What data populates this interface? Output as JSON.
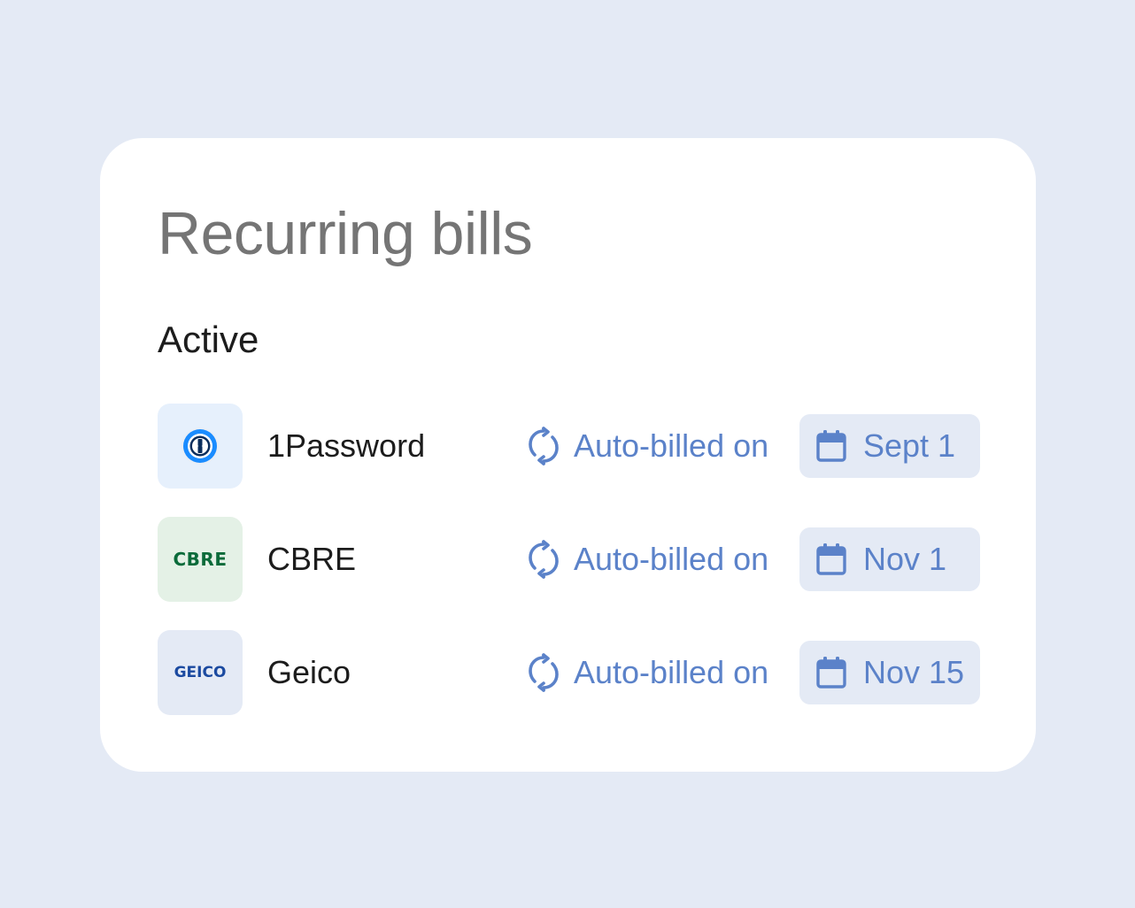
{
  "title": "Recurring bills",
  "section_label": "Active",
  "bills": [
    {
      "name": "1Password",
      "logo": {
        "kind": "1password-logo-icon",
        "text": "1",
        "bg": "#e6f0fc"
      },
      "status": "Auto-billed on",
      "status_icon": "sync-icon",
      "date_icon": "calendar-icon",
      "date": "Sept 1"
    },
    {
      "name": "CBRE",
      "logo": {
        "kind": "cbre-logo",
        "text": "CBRE",
        "bg": "#e4f1e6",
        "color": "#0a6b3a"
      },
      "status": "Auto-billed on",
      "status_icon": "sync-icon",
      "date_icon": "calendar-icon",
      "date": "Nov 1"
    },
    {
      "name": "Geico",
      "logo": {
        "kind": "geico-logo",
        "text": "GEICO",
        "bg": "#e4eaf5",
        "color": "#1b4aa0"
      },
      "status": "Auto-billed on",
      "status_icon": "sync-icon",
      "date_icon": "calendar-icon",
      "date": "Nov 15"
    }
  ],
  "colors": {
    "page_bg": "#e4eaf5",
    "card_bg": "#ffffff",
    "accent": "#5b82c9",
    "chip_bg": "#e4eaf5",
    "title": "#757575",
    "text": "#1c1c1c"
  }
}
